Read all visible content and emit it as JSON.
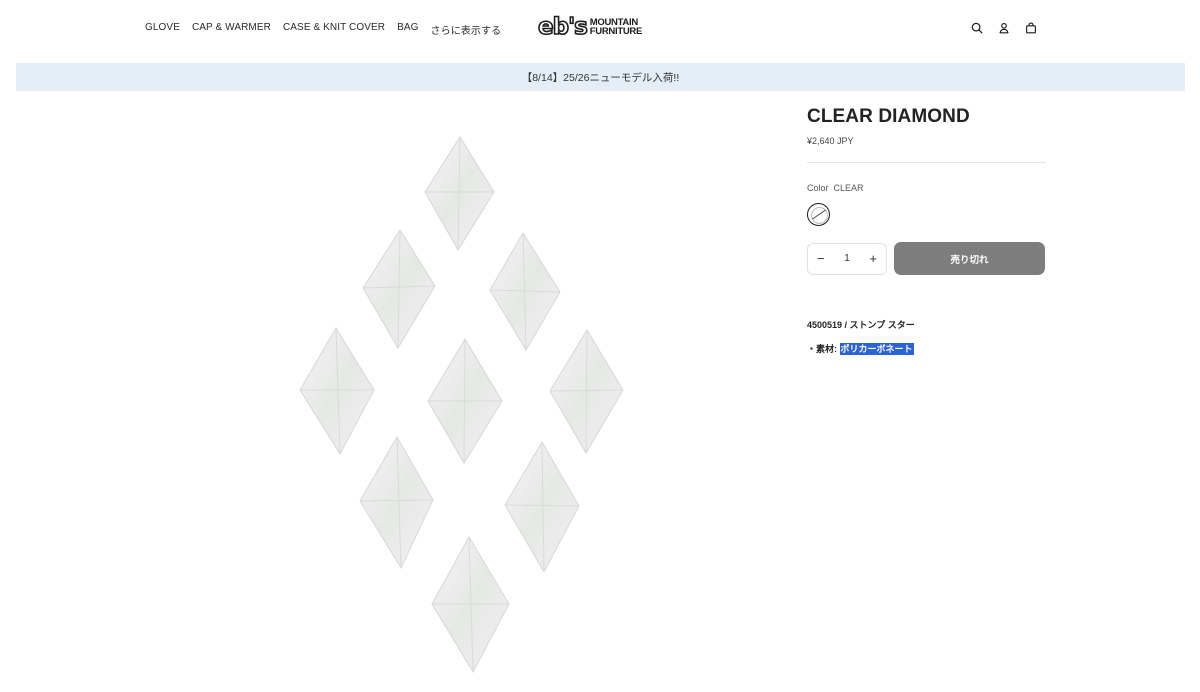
{
  "header": {
    "nav": [
      "GLOVE",
      "CAP & WARMER",
      "CASE & KNIT COVER",
      "BAG",
      "さらに表示する"
    ],
    "logo": {
      "mark": "eb's",
      "line1": "MOUNTAIN",
      "line2": "FURNITURE"
    },
    "icons": [
      "search-icon",
      "account-icon",
      "cart-icon"
    ]
  },
  "announcement": "【8/14】25/26ニューモデル入荷!!",
  "product": {
    "title": "CLEAR DIAMOND",
    "price": "¥2,640 JPY",
    "color_label": "Color",
    "color_value": "CLEAR",
    "quantity": "1",
    "qty_minus": "−",
    "qty_plus": "+",
    "sold_out_label": "売り切れ",
    "code": "4500519 / ストンプ スター",
    "material_prefix": "・素材: ",
    "material_value": "ポリカーボネート"
  },
  "colors": {
    "announce_bg": "#e3eef7",
    "soldout_bg": "#7d7d7d",
    "highlight": "#2b62d6"
  }
}
